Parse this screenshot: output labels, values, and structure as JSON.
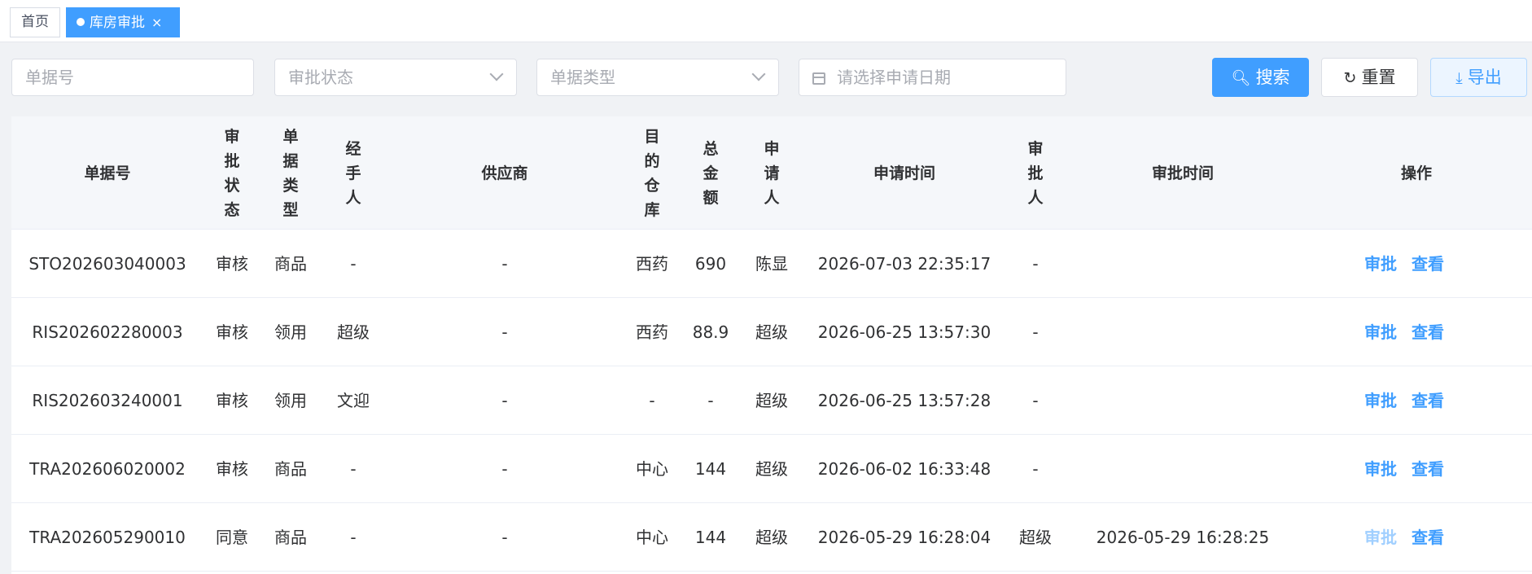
{
  "tabs": {
    "home": "首页",
    "active": "库房审批",
    "close": "×"
  },
  "filters": {
    "doc_no_placeholder": "单据号",
    "status_placeholder": "审批状态",
    "type_placeholder": "单据类型",
    "date_placeholder": "请选择申请日期"
  },
  "buttons": {
    "search": "搜索",
    "reset": "重置",
    "export": "导出"
  },
  "icons": {
    "search": "search-icon",
    "reset": "refresh-icon",
    "export": "download-icon",
    "date": "calendar-icon",
    "dropdown": "chevron-down-icon"
  },
  "colors": {
    "primary": "#409eff",
    "header_bg": "#f5f7fa",
    "page_bg": "#f0f2f5"
  },
  "table": {
    "columns": [
      "单据号",
      "审\n批\n状\n态",
      "单\n据\n类\n型",
      "经\n手\n人",
      "供应商",
      "目\n的\n仓\n库",
      "总\n金\n额",
      "申\n请\n人",
      "申请时间",
      "审\n批\n人",
      "审批时间",
      "操作"
    ],
    "rows": [
      {
        "no": "STO202603040003",
        "status": "审核",
        "type": "商品",
        "handler": "-",
        "supplier": "-",
        "warehouse": "西药",
        "amount": "690",
        "applicant": "陈显",
        "apply_time": "2026-07-03 22:35:17",
        "approver": "-",
        "approve_time": "",
        "approve": "审批",
        "view": "查看"
      },
      {
        "no": "RIS202602280003",
        "status": "审核",
        "type": "领用",
        "handler": "超级",
        "supplier": "-",
        "warehouse": "西药",
        "amount": "88.9",
        "applicant": "超级",
        "apply_time": "2026-06-25 13:57:30",
        "approver": "-",
        "approve_time": "",
        "approve": "审批",
        "view": "查看"
      },
      {
        "no": "RIS202603240001",
        "status": "审核",
        "type": "领用",
        "handler": "文迎",
        "supplier": "-",
        "warehouse": "-",
        "amount": "-",
        "applicant": "超级",
        "apply_time": "2026-06-25 13:57:28",
        "approver": "-",
        "approve_time": "",
        "approve": "审批",
        "view": "查看"
      },
      {
        "no": "TRA202606020002",
        "status": "审核",
        "type": "商品",
        "handler": "-",
        "supplier": "-",
        "warehouse": "中心",
        "amount": "144",
        "applicant": "超级",
        "apply_time": "2026-06-02 16:33:48",
        "approver": "-",
        "approve_time": "",
        "approve": "审批",
        "view": "查看"
      },
      {
        "no": "TRA202605290010",
        "status": "同意",
        "type": "商品",
        "handler": "-",
        "supplier": "-",
        "warehouse": "中心",
        "amount": "144",
        "applicant": "超级",
        "apply_time": "2026-05-29 16:28:04",
        "approver": "超级",
        "approve_time": "2026-05-29 16:28:25",
        "approve": "审批",
        "view": "查看"
      }
    ]
  }
}
